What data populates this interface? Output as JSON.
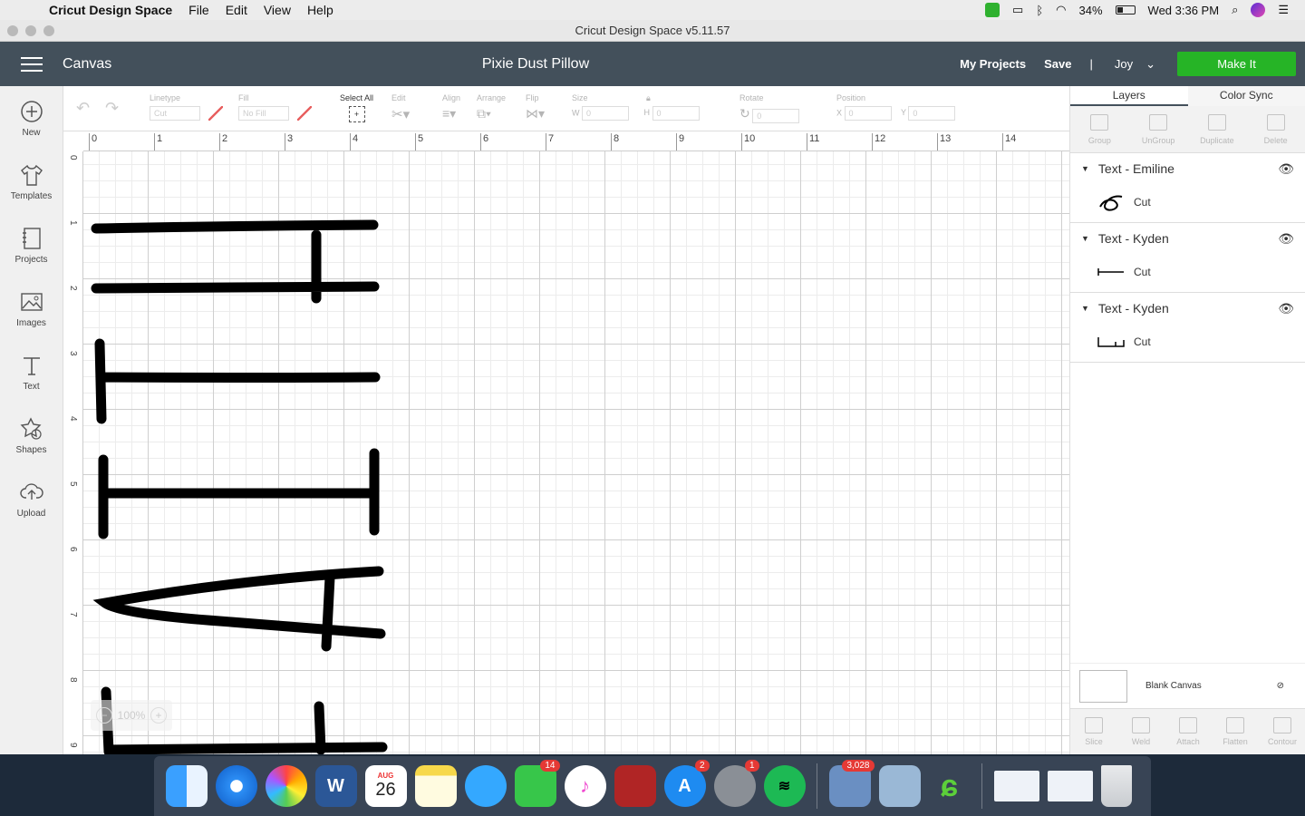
{
  "menubar": {
    "app_name": "Cricut Design Space",
    "items": [
      "File",
      "Edit",
      "View",
      "Help"
    ],
    "battery": "34%",
    "clock": "Wed 3:36 PM"
  },
  "window": {
    "title": "Cricut Design Space  v5.11.57"
  },
  "header": {
    "section": "Canvas",
    "project_title": "Pixie Dust Pillow",
    "my_projects": "My Projects",
    "save": "Save",
    "separator": "|",
    "user": "Joy",
    "make_it": "Make It"
  },
  "sidebar": {
    "items": [
      {
        "label": "New",
        "icon": "plus-circle-icon"
      },
      {
        "label": "Templates",
        "icon": "shirt-icon"
      },
      {
        "label": "Projects",
        "icon": "notebook-icon"
      },
      {
        "label": "Images",
        "icon": "image-icon"
      },
      {
        "label": "Text",
        "icon": "text-icon"
      },
      {
        "label": "Shapes",
        "icon": "shapes-icon"
      },
      {
        "label": "Upload",
        "icon": "cloud-upload-icon"
      }
    ]
  },
  "toolbar": {
    "linetype_label": "Linetype",
    "linetype_value": "Cut",
    "fill_label": "Fill",
    "fill_value": "No Fill",
    "select_all": "Select All",
    "edit": "Edit",
    "align": "Align",
    "arrange": "Arrange",
    "flip": "Flip",
    "size": "Size",
    "w": "W",
    "h": "H",
    "rotate": "Rotate",
    "position": "Position",
    "x": "X",
    "y": "Y",
    "zero": "0"
  },
  "ruler": {
    "top": [
      "0",
      "1",
      "2",
      "3",
      "4",
      "5",
      "6",
      "7",
      "8",
      "9",
      "10",
      "11",
      "12",
      "13",
      "14"
    ],
    "left": [
      "0",
      "1",
      "2",
      "3",
      "4",
      "5",
      "6",
      "7",
      "8",
      "9"
    ]
  },
  "zoom": {
    "level": "100%",
    "minus": "−",
    "plus": "+"
  },
  "panel": {
    "tabs": [
      "Layers",
      "Color Sync"
    ],
    "tools": [
      "Group",
      "UnGroup",
      "Duplicate",
      "Delete"
    ],
    "layers": [
      {
        "name": "Text - Emiline",
        "op": "Cut"
      },
      {
        "name": "Text - Kyden",
        "op": "Cut"
      },
      {
        "name": "Text - Kyden",
        "op": "Cut"
      }
    ],
    "blank_canvas": "Blank Canvas",
    "bottom_tools": [
      "Slice",
      "Weld",
      "Attach",
      "Flatten",
      "Contour"
    ]
  },
  "dock": {
    "calendar_month": "AUG",
    "calendar_day": "26",
    "badges": {
      "facetime": "14",
      "appstore": "2",
      "settings": "1",
      "mail": "3,028"
    }
  }
}
